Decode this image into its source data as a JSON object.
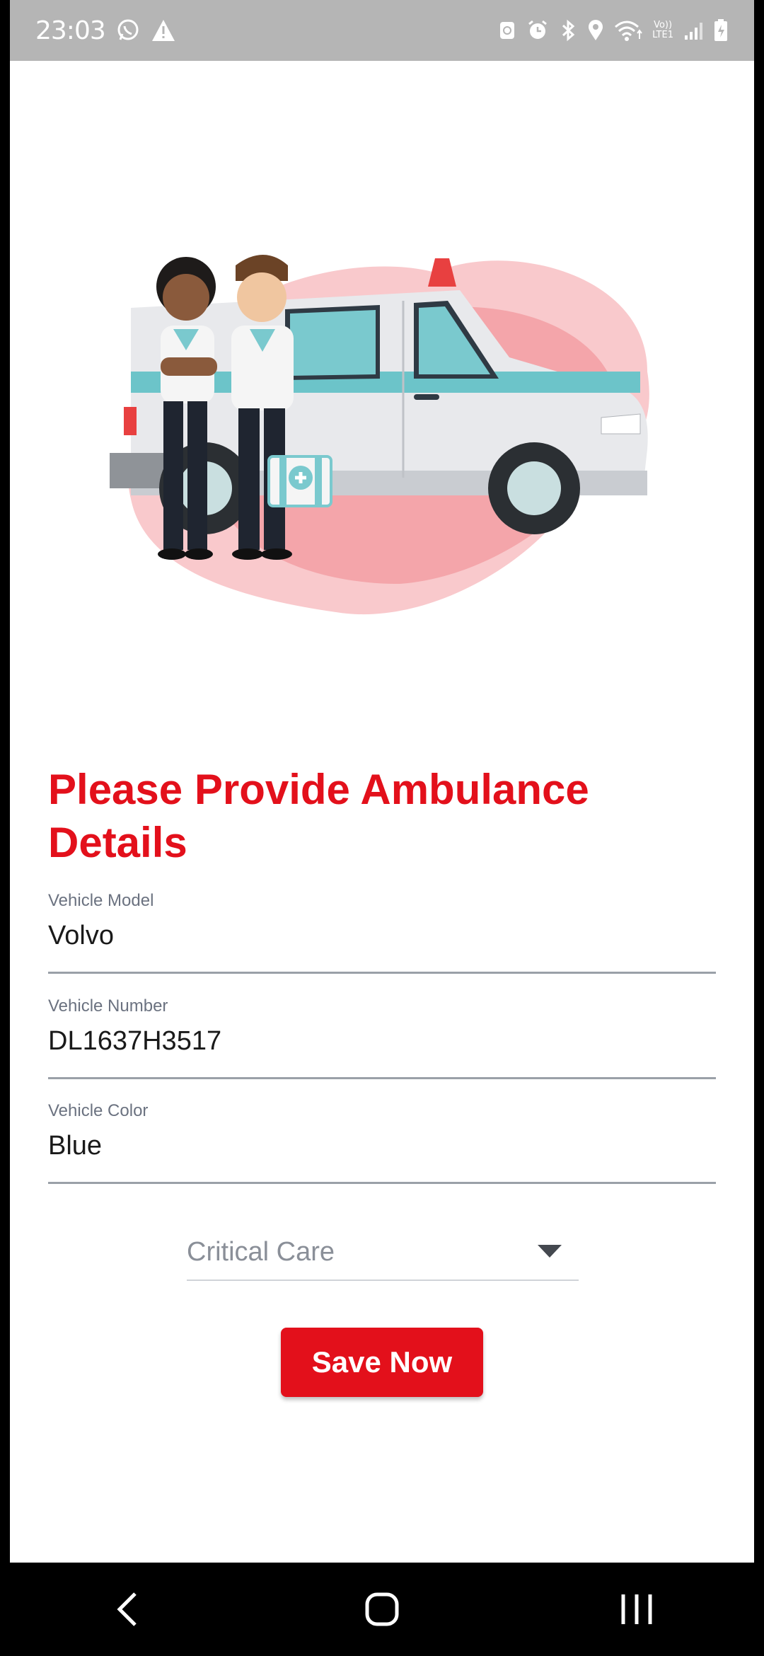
{
  "status_bar": {
    "time": "23:03",
    "left_icons": [
      "whatsapp-icon",
      "warning-icon"
    ],
    "right_icons": [
      "nfc-icon",
      "alarm-icon",
      "bluetooth-icon",
      "location-icon",
      "wifi-icon",
      "volte-icon",
      "signal-icon",
      "battery-icon"
    ],
    "volte_text": "Vo))",
    "lte_text": "LTE1"
  },
  "illustration": {
    "name": "ambulance-with-paramedics",
    "accent": "#f7a8ac"
  },
  "form": {
    "title": "Please Provide Ambulance Details",
    "fields": [
      {
        "label": "Vehicle Model",
        "value": "Volvo"
      },
      {
        "label": "Vehicle Number",
        "value": "DL1637H3517"
      },
      {
        "label": "Vehicle Color",
        "value": "Blue"
      }
    ],
    "ambulance_type": {
      "selected": "Critical Care"
    },
    "save_label": "Save Now"
  },
  "nav_bar": {
    "buttons": [
      "back-icon",
      "home-icon",
      "recents-icon"
    ]
  },
  "colors": {
    "accent": "#e3101b",
    "status_bar": "#b5b5b5",
    "nav_bar": "#000000"
  }
}
